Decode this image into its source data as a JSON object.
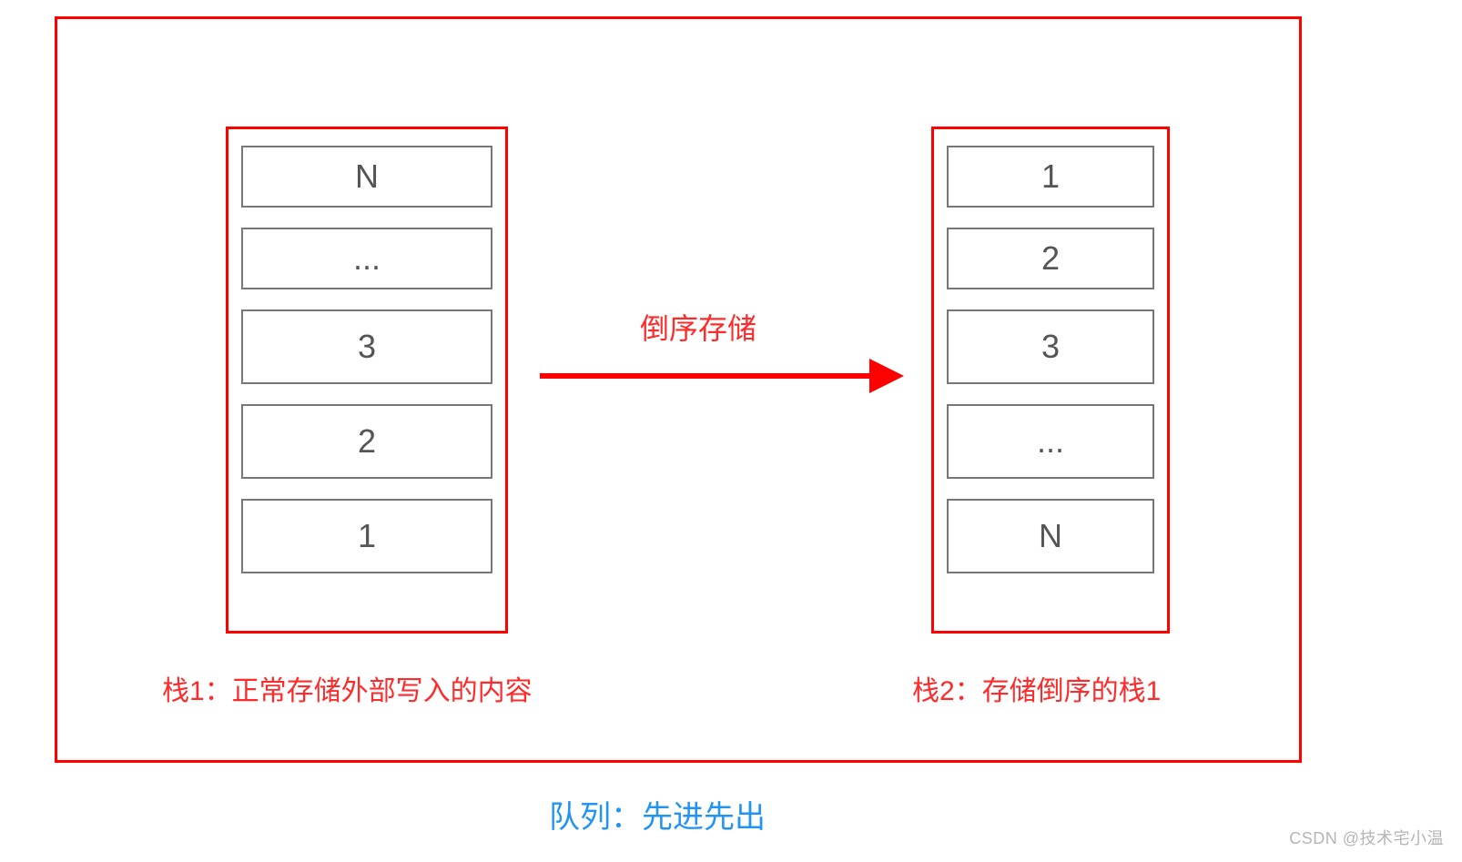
{
  "stacks": {
    "left": {
      "cells": [
        "N",
        "...",
        "3",
        "2",
        "1"
      ],
      "label": "栈1：正常存储外部写入的内容"
    },
    "right": {
      "cells": [
        "1",
        "2",
        "3",
        "...",
        "N"
      ],
      "label": "栈2：存储倒序的栈1"
    }
  },
  "arrow_label": "倒序存储",
  "queue_label": "队列：先进先出",
  "watermark": "CSDN @技术宅小温"
}
